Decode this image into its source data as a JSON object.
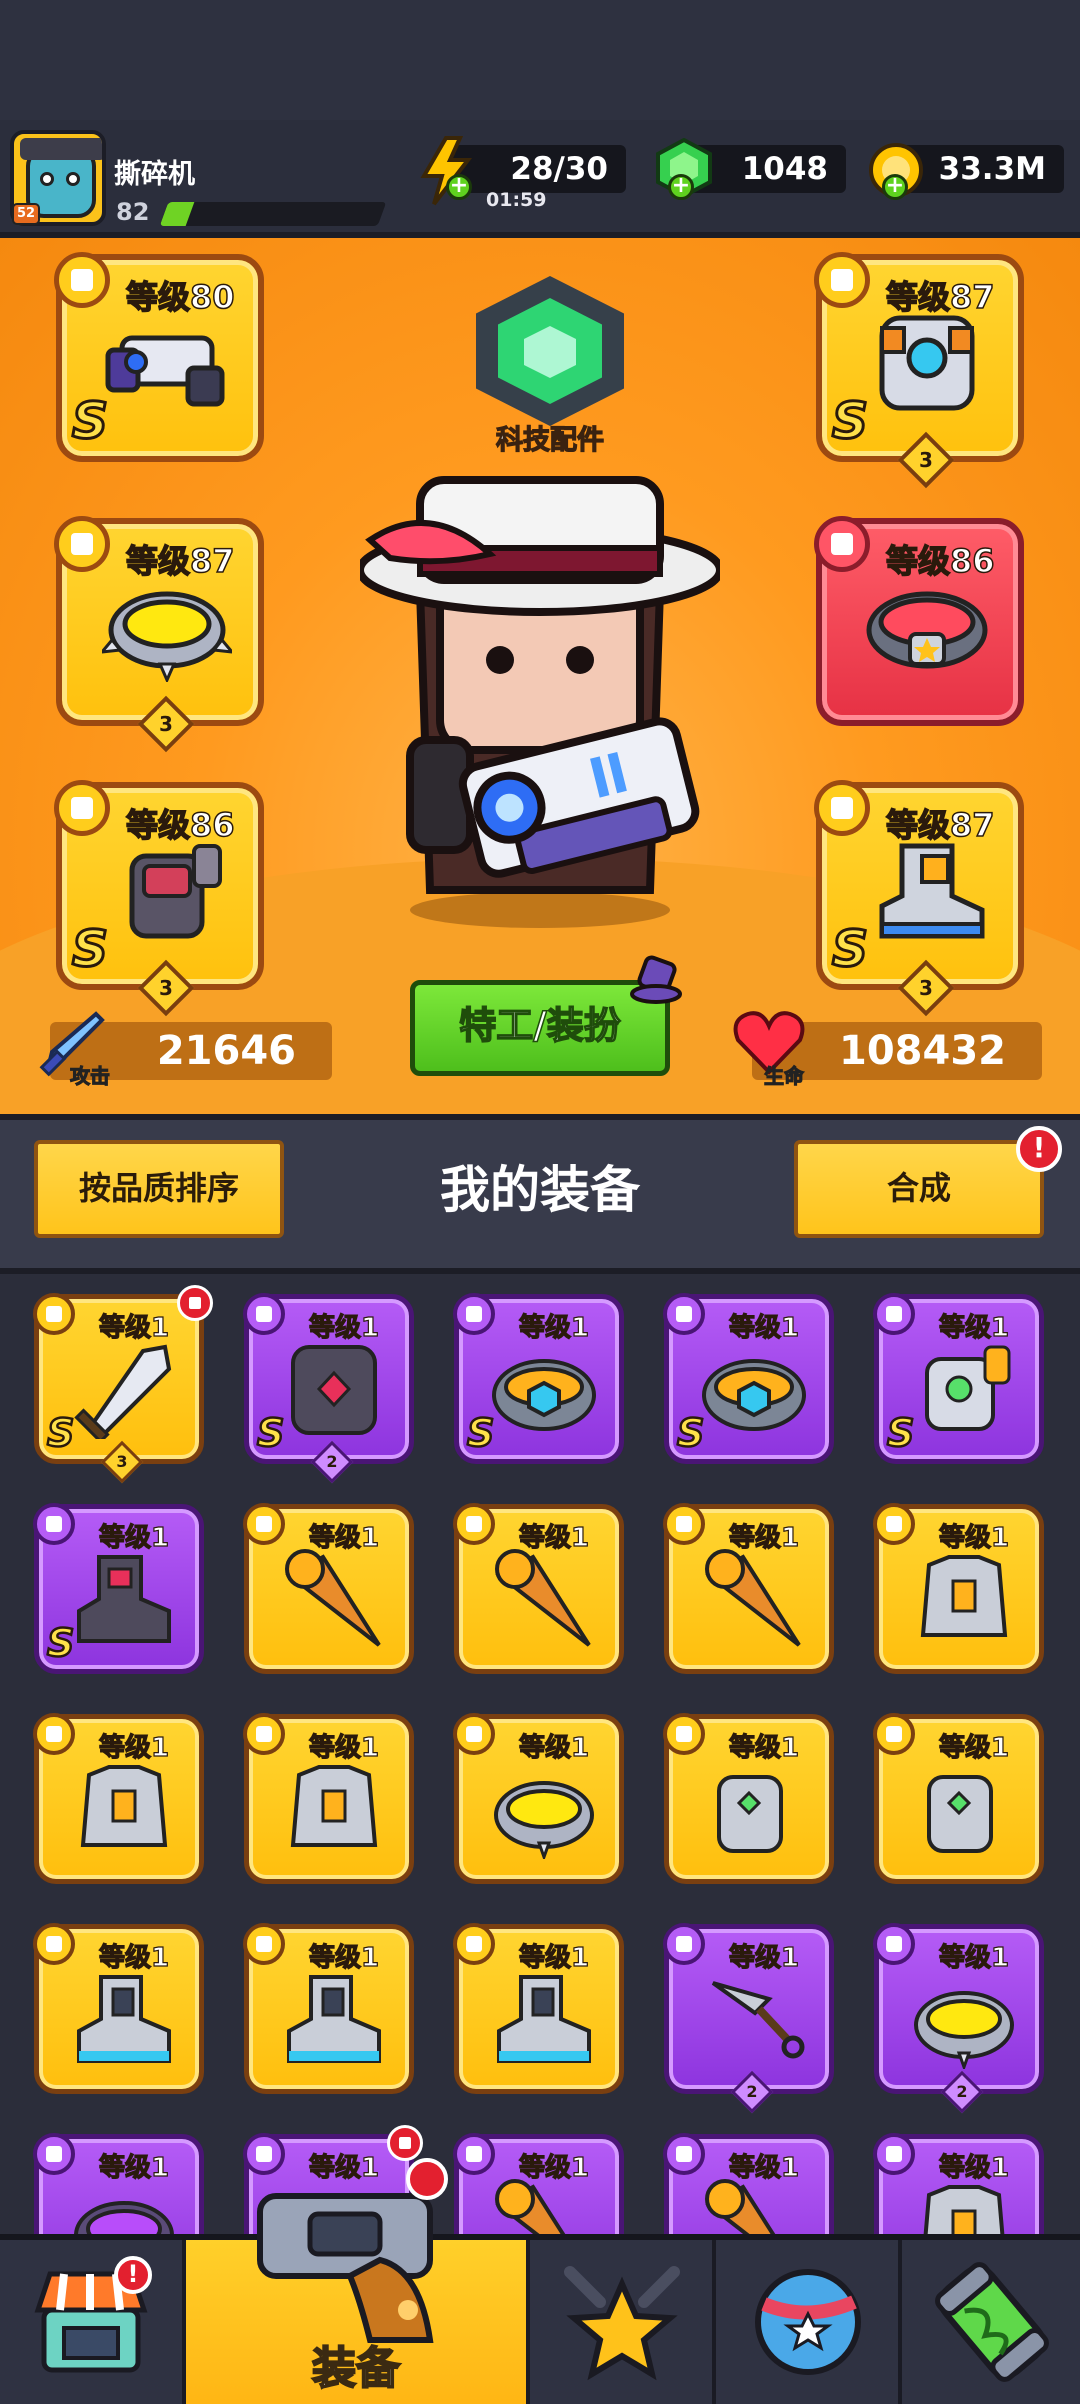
{
  "player": {
    "name": "撕碎机",
    "level": "82",
    "avatar_level": "52",
    "xp_progress": 0.12
  },
  "resources": {
    "energy": {
      "value": "28/30",
      "timer": "01:59",
      "icon": "lightning-icon"
    },
    "gems": {
      "value": "1048",
      "icon": "green-gem-icon"
    },
    "coins": {
      "value": "33.3M",
      "icon": "gold-coin-icon"
    }
  },
  "hero": {
    "tech_label": "科技配件",
    "agent_button": "特工/装扮",
    "attack": {
      "value": "21646",
      "label": "攻击",
      "icon": "sword-icon"
    },
    "life": {
      "value": "108432",
      "label": "生命",
      "icon": "heart-icon"
    },
    "slots": [
      {
        "level": "等级80",
        "rank": "S",
        "stars": "",
        "type": "weapon",
        "item": "blaster-gun"
      },
      {
        "level": "等级87",
        "rank": "S",
        "stars": "3",
        "type": "armor",
        "item": "mech-armor"
      },
      {
        "level": "等级87",
        "rank": "",
        "stars": "3",
        "type": "necklace",
        "item": "spiked-ring"
      },
      {
        "level": "等级86",
        "rank": "",
        "stars": "",
        "type": "belt",
        "item": "star-belt"
      },
      {
        "level": "等级86",
        "rank": "S",
        "stars": "3",
        "type": "gloves",
        "item": "spiked-glove"
      },
      {
        "level": "等级87",
        "rank": "S",
        "stars": "3",
        "type": "boots",
        "item": "mech-boot"
      }
    ]
  },
  "equipment": {
    "sort_button": "按品质排序",
    "title": "我的装备",
    "merge_button": "合成",
    "merge_alert": "!",
    "items": [
      {
        "level": "等级1",
        "rank": "S",
        "stars": "3",
        "quality": "gold",
        "item": "sword",
        "dot": true
      },
      {
        "level": "等级1",
        "rank": "S",
        "stars": "2",
        "quality": "purple",
        "item": "dark-armor",
        "dot": false
      },
      {
        "level": "等级1",
        "rank": "S",
        "stars": "",
        "quality": "purple",
        "item": "gem-belt",
        "dot": false
      },
      {
        "level": "等级1",
        "rank": "S",
        "stars": "",
        "quality": "purple",
        "item": "gem-belt",
        "dot": false
      },
      {
        "level": "等级1",
        "rank": "S",
        "stars": "",
        "quality": "purple",
        "item": "gauntlet",
        "dot": false
      },
      {
        "level": "等级1",
        "rank": "S",
        "stars": "",
        "quality": "purple",
        "item": "dark-boot",
        "dot": false
      },
      {
        "level": "等级1",
        "rank": "",
        "stars": "",
        "quality": "gold",
        "item": "drill",
        "dot": false
      },
      {
        "level": "等级1",
        "rank": "",
        "stars": "",
        "quality": "gold",
        "item": "drill",
        "dot": false
      },
      {
        "level": "等级1",
        "rank": "",
        "stars": "",
        "quality": "gold",
        "item": "drill",
        "dot": false
      },
      {
        "level": "等级1",
        "rank": "",
        "stars": "",
        "quality": "gold",
        "item": "vest",
        "dot": false
      },
      {
        "level": "等级1",
        "rank": "",
        "stars": "",
        "quality": "gold",
        "item": "vest",
        "dot": false
      },
      {
        "level": "等级1",
        "rank": "",
        "stars": "",
        "quality": "gold",
        "item": "vest",
        "dot": false
      },
      {
        "level": "等级1",
        "rank": "",
        "stars": "",
        "quality": "gold",
        "item": "spiked-ring",
        "dot": false
      },
      {
        "level": "等级1",
        "rank": "",
        "stars": "",
        "quality": "gold",
        "item": "glove",
        "dot": false
      },
      {
        "level": "等级1",
        "rank": "",
        "stars": "",
        "quality": "gold",
        "item": "glove",
        "dot": false
      },
      {
        "level": "等级1",
        "rank": "",
        "stars": "",
        "quality": "gold",
        "item": "boot",
        "dot": false
      },
      {
        "level": "等级1",
        "rank": "",
        "stars": "",
        "quality": "gold",
        "item": "boot",
        "dot": false
      },
      {
        "level": "等级1",
        "rank": "",
        "stars": "",
        "quality": "gold",
        "item": "boot",
        "dot": false
      },
      {
        "level": "等级1",
        "rank": "",
        "stars": "2",
        "quality": "purple",
        "item": "kunai",
        "dot": false
      },
      {
        "level": "等级1",
        "rank": "",
        "stars": "2",
        "quality": "purple",
        "item": "spiked-ring",
        "dot": false
      },
      {
        "level": "等级1",
        "rank": "",
        "stars": "",
        "quality": "purple",
        "item": "ring",
        "dot": false
      },
      {
        "level": "等级1",
        "rank": "",
        "stars": "",
        "quality": "purple",
        "item": "gun",
        "dot": true
      },
      {
        "level": "等级1",
        "rank": "",
        "stars": "",
        "quality": "purple",
        "item": "drill",
        "dot": false
      },
      {
        "level": "等级1",
        "rank": "",
        "stars": "",
        "quality": "purple",
        "item": "drill",
        "dot": false
      },
      {
        "level": "等级1",
        "rank": "",
        "stars": "",
        "quality": "purple",
        "item": "vest",
        "dot": false
      }
    ]
  },
  "nav": {
    "tabs": [
      {
        "name": "shop",
        "label": "",
        "icon": "shop-icon",
        "alert": "!"
      },
      {
        "name": "equipment",
        "label": "装备",
        "icon": "revolver-icon",
        "alert": ""
      },
      {
        "name": "battle",
        "label": "",
        "icon": "star-swords-icon",
        "alert": ""
      },
      {
        "name": "world",
        "label": "",
        "icon": "planet-icon",
        "alert": ""
      },
      {
        "name": "evolve",
        "label": "",
        "icon": "dna-capsule-icon",
        "alert": ""
      }
    ]
  },
  "colors": {
    "orange_bg": "#ff9a1f",
    "gold_card": "#ffc10d",
    "purple_card": "#8d34de",
    "green_btn": "#4ebf1c"
  }
}
